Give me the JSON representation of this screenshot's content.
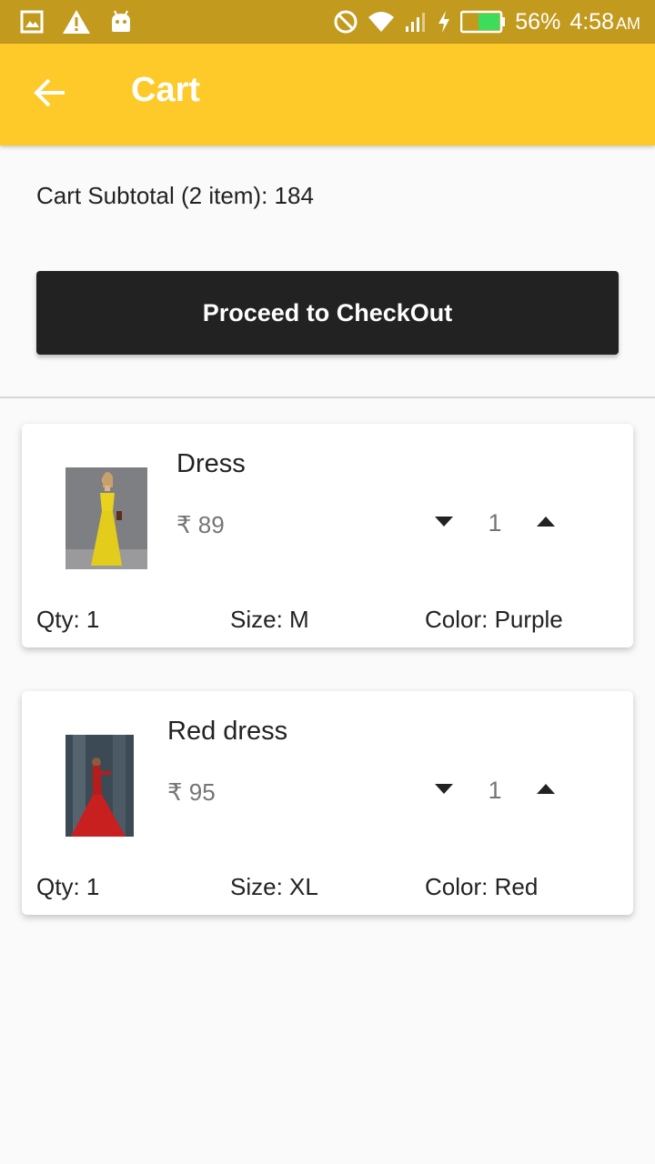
{
  "status_bar": {
    "battery": "56%",
    "time": "4:58",
    "ampm": "AM",
    "icons": [
      "image-icon",
      "warning-icon",
      "android-icon",
      "do-not-disturb-icon",
      "wifi-icon",
      "signal-icon",
      "charging-icon",
      "battery-icon"
    ]
  },
  "app_bar": {
    "title": "Cart",
    "back_icon": "arrow-back-icon",
    "color": "#fdca2a"
  },
  "subtotal": "Cart Subtotal (2 item): 184",
  "checkout_label": "Proceed to CheckOut",
  "items": [
    {
      "name": "Dress",
      "price": "₹ 89",
      "quantity": "1",
      "qty_label": "Qty: 1",
      "size_label": "Size: M",
      "color_label": "Color: Purple",
      "image_icon": "yellow-dress-photo"
    },
    {
      "name": "Red dress",
      "price": "₹ 95",
      "quantity": "1",
      "qty_label": "Qty: 1",
      "size_label": "Size: XL",
      "color_label": "Color: Red",
      "image_icon": "red-dress-photo"
    }
  ]
}
